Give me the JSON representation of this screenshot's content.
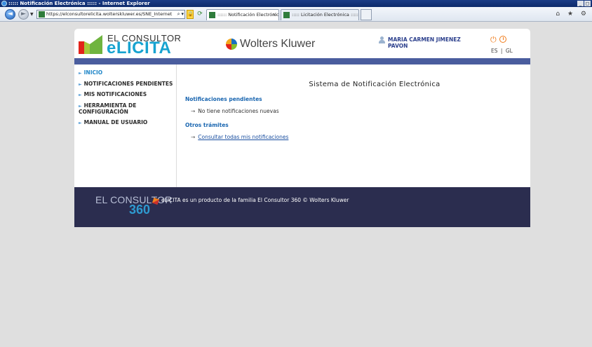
{
  "browser": {
    "window_title": "::::: Notificación Electrónica ::::: - Internet Explorer",
    "address": "https://elconsultorelicita.wolterskluwer.es/SNE_Internet",
    "tabs": [
      {
        "label": ":::::: Notificación Electrónic...",
        "active": true
      },
      {
        "label": "::::: Licitación Electrónica :::::",
        "active": false
      }
    ],
    "close_tab_glyph": "×",
    "window_buttons": [
      "_",
      "◻",
      "×"
    ],
    "right_icons": "⌂ ★ ⚙"
  },
  "header": {
    "logo_line1": "EL CONSULTOR",
    "logo_line2": "eLICITA",
    "brand": "Wolters Kluwer",
    "user_name": "MARIA CARMEN JIMENEZ PAVON",
    "lang_es": "ES",
    "lang_sep": "|",
    "lang_gl": "GL",
    "colors": {
      "accent": "#17a3d0",
      "bar": "#4a5d9e",
      "footer": "#2b2d4f",
      "power": "#f07b1a"
    }
  },
  "sidebar": {
    "items": [
      {
        "label": "INICIO",
        "active": true
      },
      {
        "label": "NOTIFICACIONES PENDIENTES",
        "active": false
      },
      {
        "label": "MIS NOTIFICACIONES",
        "active": false
      },
      {
        "label": "HERRAMIENTA DE CONFIGURACIÓN",
        "active": false
      },
      {
        "label": "MANUAL DE USUARIO",
        "active": false
      }
    ]
  },
  "main": {
    "title": "Sistema de Notificación Electrónica",
    "section1_title": "Notificaciones pendientes",
    "section1_text": "No tiene notificaciones nuevas",
    "section2_title": "Otros trámites",
    "section2_link": "Consultar todas mis notificaciones"
  },
  "footer": {
    "logo_line1": "EL CONSULTOR",
    "logo_line2": "360",
    "text": "eLICITA es un producto de la familia El Consultor 360  © Wolters Kluwer"
  }
}
